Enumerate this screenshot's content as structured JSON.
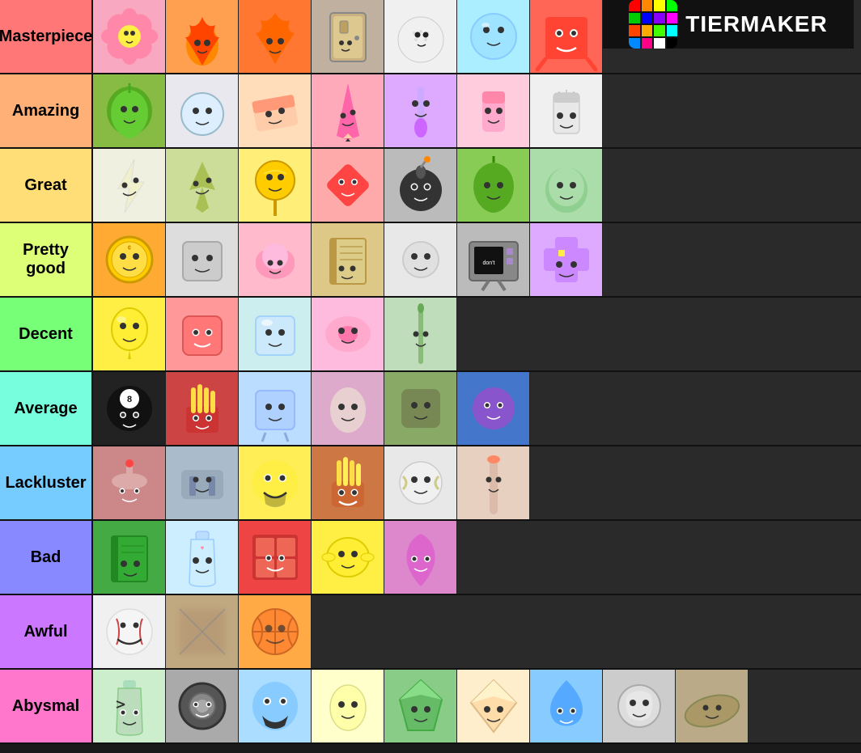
{
  "tiers": [
    {
      "id": "masterpiece",
      "label": "Masterpiece",
      "color": "#ff7777",
      "items": [
        {
          "name": "Flower",
          "bg": "#f8c8e0"
        },
        {
          "name": "Firey",
          "bg": "#ffa050"
        },
        {
          "name": "Firey Jr",
          "bg": "#ff8030"
        },
        {
          "name": "Door",
          "bg": "#e0d0c0"
        },
        {
          "name": "Golf Ball",
          "bg": "#f0f0f0"
        },
        {
          "name": "Bubble",
          "bg": "#ccf0ff"
        },
        {
          "name": "Blocky",
          "bg": "#ff7777"
        },
        {
          "name": "Logo",
          "bg": "#111111"
        }
      ]
    },
    {
      "id": "amazing",
      "label": "Amazing",
      "color": "#ffb077",
      "items": [
        {
          "name": "Leafy",
          "bg": "#88cc44"
        },
        {
          "name": "Snowball",
          "bg": "#e8e8f0"
        },
        {
          "name": "Eraser",
          "bg": "#ffccaa"
        },
        {
          "name": "Pencil",
          "bg": "#ff88aa"
        },
        {
          "name": "Paintbrush",
          "bg": "#ddaaff"
        },
        {
          "name": "Paintbrush2",
          "bg": "#ffccdd"
        },
        {
          "name": "Fanny",
          "bg": "#f0f0f0"
        }
      ]
    },
    {
      "id": "great",
      "label": "Great",
      "color": "#ffdd77",
      "items": [
        {
          "name": "Lightning",
          "bg": "#f0f0e0"
        },
        {
          "name": "Pins",
          "bg": "#ccddaa"
        },
        {
          "name": "Lollipop",
          "bg": "#ffee88"
        },
        {
          "name": "Red Arrow",
          "bg": "#ffaaaa"
        },
        {
          "name": "Bomby",
          "bg": "#cccccc"
        },
        {
          "name": "Leafy2",
          "bg": "#88cc66"
        },
        {
          "name": "Gelatin",
          "bg": "#aaddaa"
        }
      ]
    },
    {
      "id": "prettygood",
      "label": "Pretty good",
      "color": "#ddff77",
      "items": [
        {
          "name": "Coiny",
          "bg": "#ffaa44"
        },
        {
          "name": "Gray Square",
          "bg": "#dddddd"
        },
        {
          "name": "Cloudy",
          "bg": "#ffbbcc"
        },
        {
          "name": "Book",
          "bg": "#ddcc88"
        },
        {
          "name": "Bell",
          "bg": "#eeeeee"
        },
        {
          "name": "TV",
          "bg": "#cccccc"
        },
        {
          "name": "Purple Cross",
          "bg": "#ddaaff"
        }
      ]
    },
    {
      "id": "decent",
      "label": "Decent",
      "color": "#77ff77",
      "items": [
        {
          "name": "Balloony",
          "bg": "#ffee44"
        },
        {
          "name": "Nickel",
          "bg": "#ff9999"
        },
        {
          "name": "Ice Cube",
          "bg": "#cce8ff"
        },
        {
          "name": "Donut",
          "bg": "#ffbbdd"
        },
        {
          "name": "Needle",
          "bg": "#c8e8c8"
        }
      ]
    },
    {
      "id": "average",
      "label": "Average",
      "color": "#77ffdd",
      "items": [
        {
          "name": "8-Ball",
          "bg": "#222222"
        },
        {
          "name": "Fries",
          "bg": "#cc4444"
        },
        {
          "name": "Ice Cube2",
          "bg": "#ccf0ff"
        },
        {
          "name": "Eggy",
          "bg": "#ddaacc"
        },
        {
          "name": "Bracelety",
          "bg": "#88aa66"
        },
        {
          "name": "Purple Ball",
          "bg": "#4488cc"
        }
      ]
    },
    {
      "id": "lackluster",
      "label": "Lackluster",
      "color": "#77ccff",
      "items": [
        {
          "name": "Cake",
          "bg": "#cc8888"
        },
        {
          "name": "Stapy",
          "bg": "#aaccdd"
        },
        {
          "name": "Yellow Face",
          "bg": "#ffdd44"
        },
        {
          "name": "Fries2",
          "bg": "#cc7744"
        },
        {
          "name": "Tennis Ball",
          "bg": "#e8e8e8"
        },
        {
          "name": "Licky",
          "bg": "#e8d0c0"
        }
      ]
    },
    {
      "id": "bad",
      "label": "Bad",
      "color": "#8888ff",
      "items": [
        {
          "name": "Book2",
          "bg": "#44aa44"
        },
        {
          "name": "Bottle",
          "bg": "#cce8ff"
        },
        {
          "name": "Red Window",
          "bg": "#ee4444"
        },
        {
          "name": "Lemon",
          "bg": "#ffee44"
        },
        {
          "name": "Pin2",
          "bg": "#dd88cc"
        }
      ]
    },
    {
      "id": "awful",
      "label": "Awful",
      "color": "#cc77ff",
      "items": [
        {
          "name": "Baseball",
          "bg": "#f0f0f0"
        },
        {
          "name": "Blur",
          "bg": "#c8b090"
        },
        {
          "name": "Basketball",
          "bg": "#ffaa44"
        }
      ]
    },
    {
      "id": "abysmal",
      "label": "Abysmal",
      "color": "#ff77cc",
      "items": [
        {
          "name": "Bottle2",
          "bg": "#cceecc"
        },
        {
          "name": "Tire",
          "bg": "#aaaaaa"
        },
        {
          "name": "Laughing",
          "bg": "#aaddff"
        },
        {
          "name": "Egg2",
          "bg": "#ffffcc"
        },
        {
          "name": "Green Gem",
          "bg": "#88cc88"
        },
        {
          "name": "Diamond",
          "bg": "#ffeecc"
        },
        {
          "name": "Teardrop",
          "bg": "#88ccff"
        },
        {
          "name": "Marble",
          "bg": "#cccccc"
        },
        {
          "name": "Flat",
          "bg": "#bbaa88"
        }
      ]
    }
  ],
  "logo": {
    "text": "TIERMAKER",
    "colors": [
      "#ff0000",
      "#ff8800",
      "#ffff00",
      "#00ff00",
      "#00ffff",
      "#0000ff",
      "#ff00ff",
      "#ffffff",
      "#000000",
      "#ff4444",
      "#44ff44",
      "#4444ff",
      "#ffff44",
      "#ff44ff",
      "#44ffff",
      "#888888"
    ]
  }
}
